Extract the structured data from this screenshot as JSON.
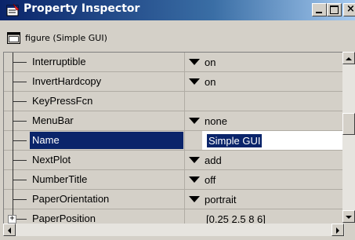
{
  "window": {
    "title": "Property Inspector",
    "title_bar_gradient": [
      "#0a246a",
      "#a6caf0"
    ],
    "controls": [
      "minimize-icon",
      "maximize-icon",
      "close-icon"
    ]
  },
  "object": {
    "label": "figure (Simple GUI)",
    "icon": "figure-icon"
  },
  "properties": [
    {
      "name": "Interruptible",
      "value": "on",
      "dropdown": true,
      "expandable": false,
      "selected": false
    },
    {
      "name": "InvertHardcopy",
      "value": "on",
      "dropdown": true,
      "expandable": false,
      "selected": false
    },
    {
      "name": "KeyPressFcn",
      "value": "",
      "dropdown": false,
      "expandable": false,
      "selected": false
    },
    {
      "name": "MenuBar",
      "value": "none",
      "dropdown": true,
      "expandable": false,
      "selected": false
    },
    {
      "name": "Name",
      "value": "Simple GUI",
      "dropdown": false,
      "expandable": false,
      "selected": true,
      "editing": true
    },
    {
      "name": "NextPlot",
      "value": "add",
      "dropdown": true,
      "expandable": false,
      "selected": false
    },
    {
      "name": "NumberTitle",
      "value": "off",
      "dropdown": true,
      "expandable": false,
      "selected": false
    },
    {
      "name": "PaperOrientation",
      "value": "portrait",
      "dropdown": true,
      "expandable": false,
      "selected": false
    },
    {
      "name": "PaperPosition",
      "value": "[0.25 2.5 8 6]",
      "dropdown": false,
      "expandable": true,
      "selected": false
    }
  ],
  "colors": {
    "selection": "#0a246a",
    "chrome": "#d4d0c8"
  },
  "scrollbars": {
    "vertical_thumb_fraction": 0.5,
    "horizontal_position": 0
  }
}
